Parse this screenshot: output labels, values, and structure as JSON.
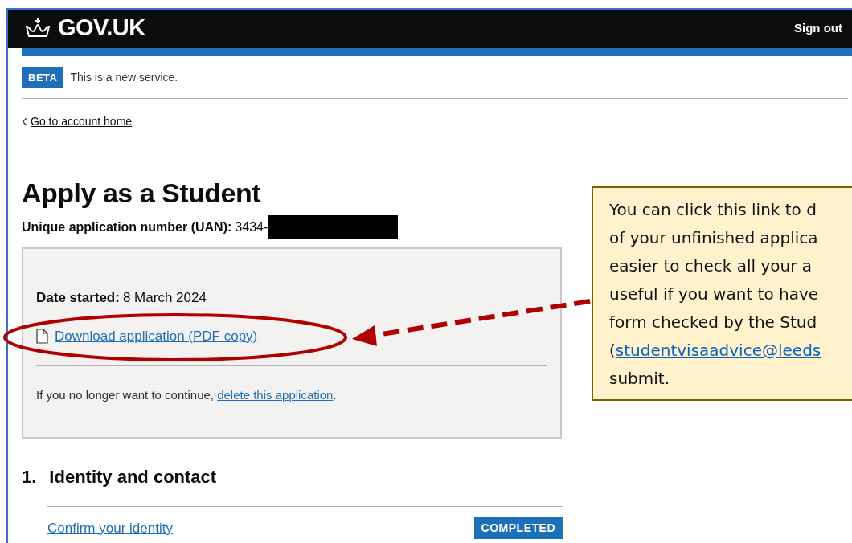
{
  "header": {
    "logo": "GOV.UK",
    "sign_out": "Sign out"
  },
  "phase_banner": {
    "tag": "BETA",
    "text": "This is a new service."
  },
  "back_link": "Go to account home",
  "title": "Apply as a Student",
  "uan": {
    "label": "Unique application number (UAN):",
    "value": "3434-"
  },
  "summary_box": {
    "date_label": "Date started:",
    "date_value": "8 March 2024",
    "download_link": "Download application (PDF copy)",
    "delete_text": "If you no longer want to continue,",
    "delete_link": "delete this application",
    "delete_end": "."
  },
  "sections": [
    {
      "number": "1.",
      "title": "Identity and contact",
      "tasks": [
        {
          "label": "Confirm your identity",
          "status": "COMPLETED"
        }
      ]
    }
  ],
  "callout": {
    "lines": [
      "You can click this link to d",
      "of your unfinished applica",
      "easier to check all your a",
      "useful if you want to have",
      "form checked by the Stud"
    ],
    "link_prefix": "(",
    "link": "studentvisaadvice@leeds",
    "last_line": "submit."
  }
}
